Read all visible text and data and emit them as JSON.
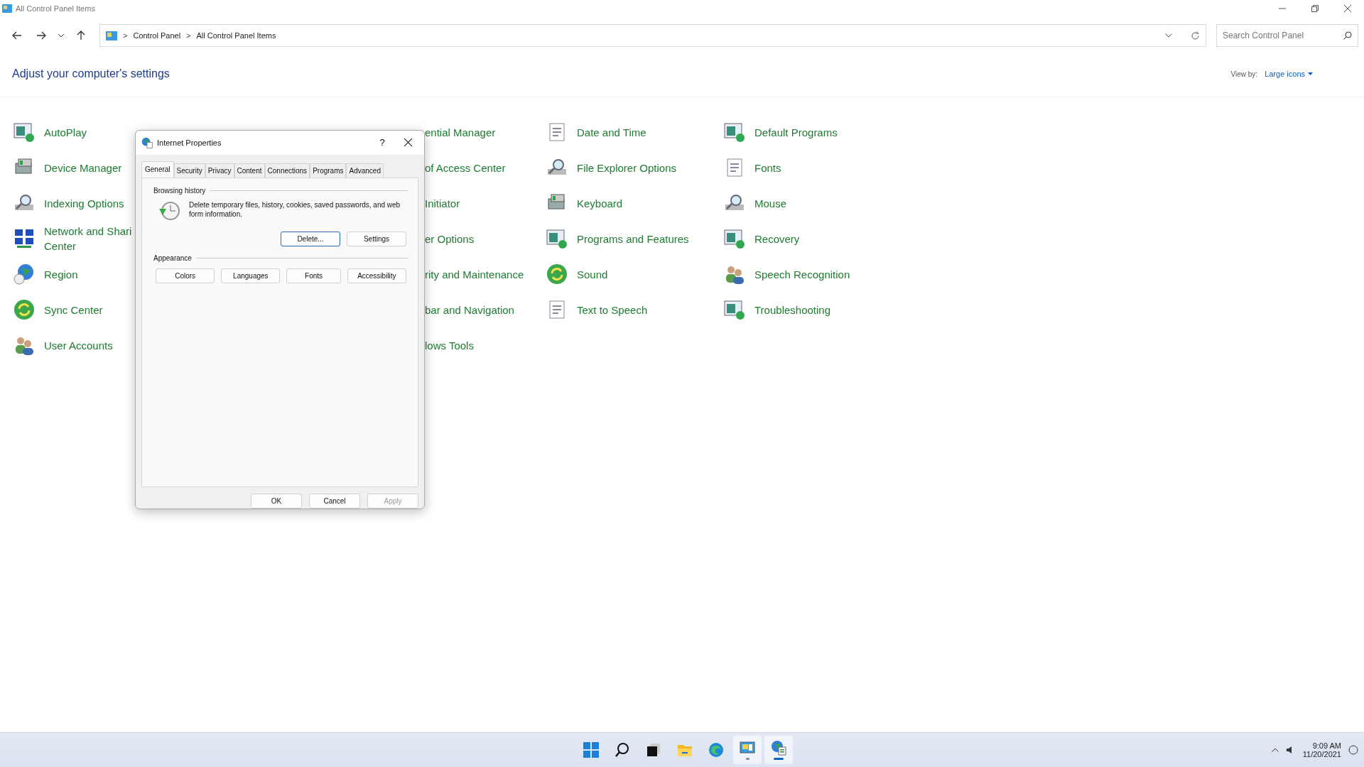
{
  "window": {
    "title": "All Control Panel Items"
  },
  "address_bar": {
    "crumbs": [
      "Control Panel",
      "All Control Panel Items"
    ],
    "separator": ">"
  },
  "search": {
    "placeholder": "Search Control Panel"
  },
  "heading": "Adjust your computer's settings",
  "view_by": {
    "label": "View by:",
    "value": "Large icons"
  },
  "columns": [
    {
      "items": [
        "AutoPlay",
        "Device Manager",
        "Indexing Options",
        "Network and Shari\nCenter",
        "Region",
        "Sync Center",
        "User Accounts"
      ]
    },
    {
      "items": [
        "ential Manager",
        "of Access Center",
        "Initiator",
        "er Options",
        "rity and Maintenance",
        "bar and Navigation",
        "lows Tools"
      ]
    },
    {
      "items": [
        "Date and Time",
        "File Explorer Options",
        "Keyboard",
        "Programs and Features",
        "Sound",
        "Text to Speech"
      ]
    },
    {
      "items": [
        "Default Programs",
        "Fonts",
        "Mouse",
        "Recovery",
        "Speech Recognition",
        "Troubleshooting"
      ]
    }
  ],
  "dialog": {
    "title": "Internet Properties",
    "help": "?",
    "tabs": [
      {
        "label": "General",
        "selected": true
      },
      {
        "label": "Security",
        "selected": false
      },
      {
        "label": "Privacy",
        "selected": false
      },
      {
        "label": "Content",
        "selected": false
      },
      {
        "label": "Connections",
        "selected": false
      },
      {
        "label": "Programs",
        "selected": false
      },
      {
        "label": "Advanced",
        "selected": false
      }
    ],
    "browsing_history": {
      "title": "Browsing history",
      "text": "Delete temporary files, history, cookies, saved passwords, and web form information.",
      "buttons": [
        {
          "label": "Delete...",
          "focused": true
        },
        {
          "label": "Settings",
          "focused": false
        }
      ]
    },
    "appearance": {
      "title": "Appearance",
      "buttons": [
        "Colors",
        "Languages",
        "Fonts",
        "Accessibility"
      ]
    },
    "footer": [
      {
        "label": "OK",
        "disabled": false
      },
      {
        "label": "Cancel",
        "disabled": false
      },
      {
        "label": "Apply",
        "disabled": true
      }
    ]
  },
  "taskbar": {
    "apps": [
      {
        "kind": "start",
        "active": false
      },
      {
        "kind": "search",
        "active": false
      },
      {
        "kind": "taskview",
        "active": false
      },
      {
        "kind": "explorer",
        "active": false
      },
      {
        "kind": "edge",
        "active": false
      },
      {
        "kind": "controlpanel",
        "active": true
      },
      {
        "kind": "internet",
        "active": true
      }
    ],
    "time": "9:09 AM",
    "date": "11/20/2021"
  }
}
